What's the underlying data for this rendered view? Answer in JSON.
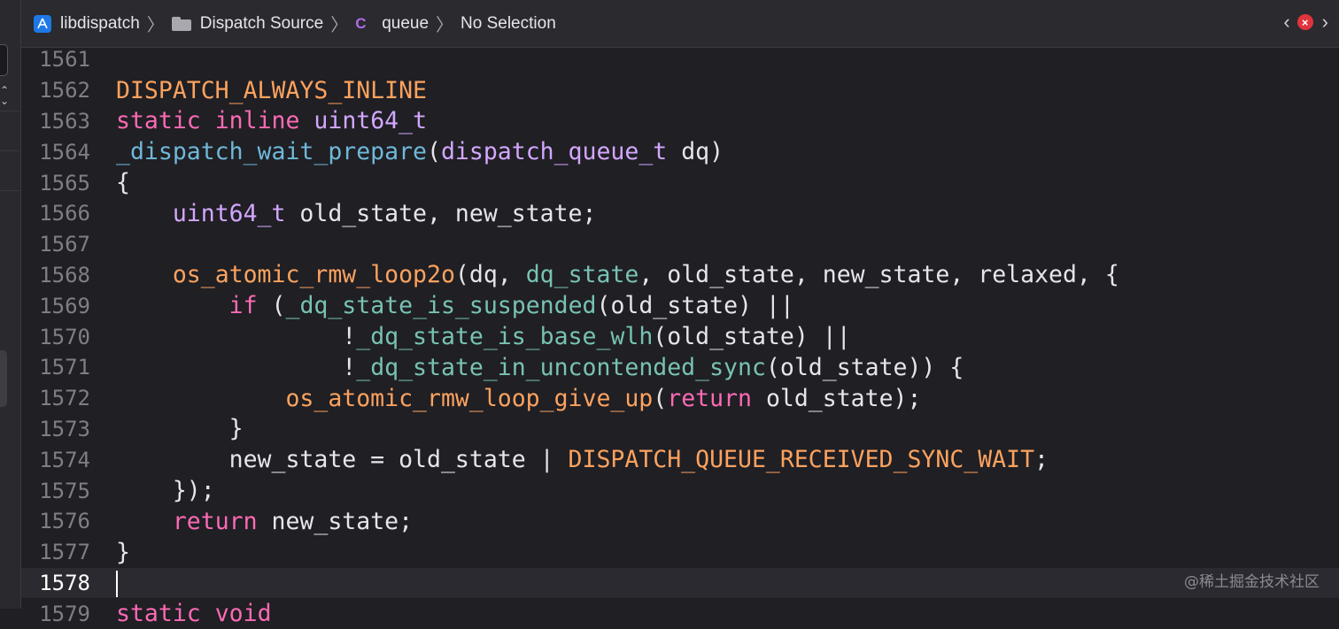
{
  "jumpbar": {
    "project": "libdispatch",
    "folder": "Dispatch Source",
    "symbol_kind": "C",
    "symbol": "queue",
    "selection": "No Selection"
  },
  "editor": {
    "current_line": "1578",
    "lines": [
      {
        "n": "1561",
        "tokens": []
      },
      {
        "n": "1562",
        "tokens": [
          {
            "c": "macro",
            "t": "DISPATCH_ALWAYS_INLINE"
          }
        ]
      },
      {
        "n": "1563",
        "tokens": [
          {
            "c": "kw",
            "t": "static"
          },
          {
            "c": "plain",
            "t": " "
          },
          {
            "c": "kw",
            "t": "inline"
          },
          {
            "c": "plain",
            "t": " "
          },
          {
            "c": "type",
            "t": "uint64_t"
          }
        ]
      },
      {
        "n": "1564",
        "tokens": [
          {
            "c": "fn",
            "t": "_dispatch_wait_prepare"
          },
          {
            "c": "plain",
            "t": "("
          },
          {
            "c": "type",
            "t": "dispatch_queue_t"
          },
          {
            "c": "plain",
            "t": " dq)"
          }
        ]
      },
      {
        "n": "1565",
        "tokens": [
          {
            "c": "plain",
            "t": "{"
          }
        ]
      },
      {
        "n": "1566",
        "tokens": [
          {
            "c": "plain",
            "t": "    "
          },
          {
            "c": "type",
            "t": "uint64_t"
          },
          {
            "c": "plain",
            "t": " old_state, new_state;"
          }
        ]
      },
      {
        "n": "1567",
        "tokens": []
      },
      {
        "n": "1568",
        "tokens": [
          {
            "c": "plain",
            "t": "    "
          },
          {
            "c": "macro",
            "t": "os_atomic_rmw_loop2o"
          },
          {
            "c": "plain",
            "t": "(dq, "
          },
          {
            "c": "call",
            "t": "dq_state"
          },
          {
            "c": "plain",
            "t": ", old_state, new_state, relaxed, {"
          }
        ]
      },
      {
        "n": "1569",
        "tokens": [
          {
            "c": "plain",
            "t": "        "
          },
          {
            "c": "kw",
            "t": "if"
          },
          {
            "c": "plain",
            "t": " ("
          },
          {
            "c": "call",
            "t": "_dq_state_is_suspended"
          },
          {
            "c": "plain",
            "t": "(old_state) ||"
          }
        ]
      },
      {
        "n": "1570",
        "tokens": [
          {
            "c": "plain",
            "t": "                !"
          },
          {
            "c": "call",
            "t": "_dq_state_is_base_wlh"
          },
          {
            "c": "plain",
            "t": "(old_state) ||"
          }
        ]
      },
      {
        "n": "1571",
        "tokens": [
          {
            "c": "plain",
            "t": "                !"
          },
          {
            "c": "call",
            "t": "_dq_state_in_uncontended_sync"
          },
          {
            "c": "plain",
            "t": "(old_state)) {"
          }
        ]
      },
      {
        "n": "1572",
        "tokens": [
          {
            "c": "plain",
            "t": "            "
          },
          {
            "c": "macro",
            "t": "os_atomic_rmw_loop_give_up"
          },
          {
            "c": "plain",
            "t": "("
          },
          {
            "c": "kw",
            "t": "return"
          },
          {
            "c": "plain",
            "t": " old_state);"
          }
        ]
      },
      {
        "n": "1573",
        "tokens": [
          {
            "c": "plain",
            "t": "        }"
          }
        ]
      },
      {
        "n": "1574",
        "tokens": [
          {
            "c": "plain",
            "t": "        new_state = old_state | "
          },
          {
            "c": "macro",
            "t": "DISPATCH_QUEUE_RECEIVED_SYNC_WAIT"
          },
          {
            "c": "plain",
            "t": ";"
          }
        ]
      },
      {
        "n": "1575",
        "tokens": [
          {
            "c": "plain",
            "t": "    });"
          }
        ]
      },
      {
        "n": "1576",
        "tokens": [
          {
            "c": "plain",
            "t": "    "
          },
          {
            "c": "kw",
            "t": "return"
          },
          {
            "c": "plain",
            "t": " new_state;"
          }
        ]
      },
      {
        "n": "1577",
        "tokens": [
          {
            "c": "plain",
            "t": "}"
          }
        ]
      },
      {
        "n": "1578",
        "tokens": []
      },
      {
        "n": "1579",
        "tokens": [
          {
            "c": "kw",
            "t": "static"
          },
          {
            "c": "plain",
            "t": " "
          },
          {
            "c": "kw",
            "t": "void"
          }
        ]
      }
    ]
  },
  "watermark": "@稀土掘金技术社区",
  "colors": {
    "keyword": "#fc6ab3",
    "type": "#d4a7ff",
    "macro": "#fda25e",
    "function_decl": "#6fb8d8",
    "function_call": "#78c2b3",
    "plain": "#e6e6ea",
    "background": "#1f1f24"
  }
}
